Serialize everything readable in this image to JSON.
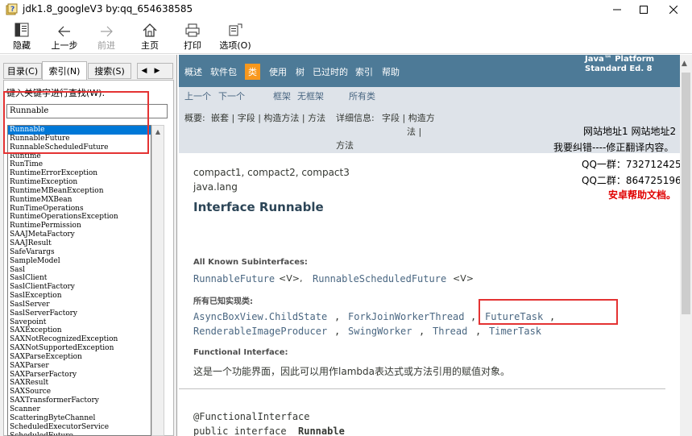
{
  "window": {
    "title": "jdk1.8_googleV3 by:qq_654638585"
  },
  "toolbar": {
    "items": [
      {
        "label": "隐藏",
        "icon": "hide-pane-icon"
      },
      {
        "label": "上一步",
        "icon": "back-arrow-icon"
      },
      {
        "label": "前进",
        "icon": "forward-arrow-icon",
        "disabled": true
      },
      {
        "label": "主页",
        "icon": "home-icon"
      },
      {
        "label": "打印",
        "icon": "print-icon"
      },
      {
        "label": "选项(O)",
        "icon": "options-icon"
      }
    ]
  },
  "left_pane": {
    "tabs": [
      "目录(C)",
      "索引(N)",
      "搜索(S)"
    ],
    "active_tab": "索引(N)",
    "keyword_label": "键入关键字进行查找(W):",
    "search_value": "Runnable",
    "list": [
      "Runnable",
      "RunnableFuture",
      "RunnableScheduledFuture",
      "Runtime",
      "RunTime",
      "RuntimeErrorException",
      "RuntimeException",
      "RuntimeMBeanException",
      "RuntimeMXBean",
      "RunTimeOperations",
      "RuntimeOperationsException",
      "RuntimePermission",
      "SAAJMetaFactory",
      "SAAJResult",
      "SafeVarargs",
      "SampleModel",
      "Sasl",
      "SaslClient",
      "SaslClientFactory",
      "SaslException",
      "SaslServer",
      "SaslServerFactory",
      "Savepoint",
      "SAXException",
      "SAXNotRecognizedException",
      "SAXNotSupportedException",
      "SAXParseException",
      "SAXParser",
      "SAXParserFactory",
      "SAXResult",
      "SAXSource",
      "SAXTransformerFactory",
      "Scanner",
      "ScatteringByteChannel",
      "ScheduledExecutorService",
      "ScheduledFuture"
    ],
    "selected_index": 0
  },
  "doc": {
    "topnav": [
      "概述",
      "软件包",
      "类",
      "使用",
      "树",
      "已过时的",
      "索引",
      "帮助"
    ],
    "topnav_current": "类",
    "platform_line1": "Java™ Platform",
    "platform_line2": "Standard Ed. 8",
    "subnav": {
      "prev": "上一个",
      "next": "下一个",
      "frames": "框架",
      "noframes": "无框架",
      "allclasses": "所有类",
      "summary_label": "概要:",
      "summary_links": "嵌套 | 字段 | 构造方法 | 方法",
      "detail_label": "详细信息:",
      "detail_links": "字段 | 构造方",
      "detail_cont1": "法 |",
      "detail_cont2": "方法"
    },
    "promo": {
      "sites": "网站地址1 网站地址2",
      "correction": "我要纠错----修正翻译内容。",
      "qq1": "QQ一群：732712425",
      "qq2": "QQ二群：864725196",
      "android": "安卓帮助文档。"
    },
    "profiles": "compact1, compact2, compact3",
    "package": "java.lang",
    "title": "Interface Runnable",
    "subinterfaces_label": "All Known Subinterfaces:",
    "subinterfaces": [
      "RunnableFuture",
      "<V>,",
      "RunnableScheduledFuture",
      "<V>"
    ],
    "implementing_label": "所有已知实现类:",
    "implementing_row1": [
      "AsyncBoxView.ChildState",
      ",",
      "ForkJoinWorkerThread",
      ",",
      "FutureTask",
      ","
    ],
    "implementing_row2": [
      "RenderableImageProducer",
      ",",
      "SwingWorker",
      ",",
      "Thread",
      ",",
      "TimerTask"
    ],
    "functional_label": "Functional Interface:",
    "functional_text": "这是一个功能界面，因此可以用作lambda表达式或方法引用的赋值对象。",
    "annotation": "@FunctionalInterface",
    "decl_prefix": "public interface ",
    "decl_name": "Runnable"
  }
}
